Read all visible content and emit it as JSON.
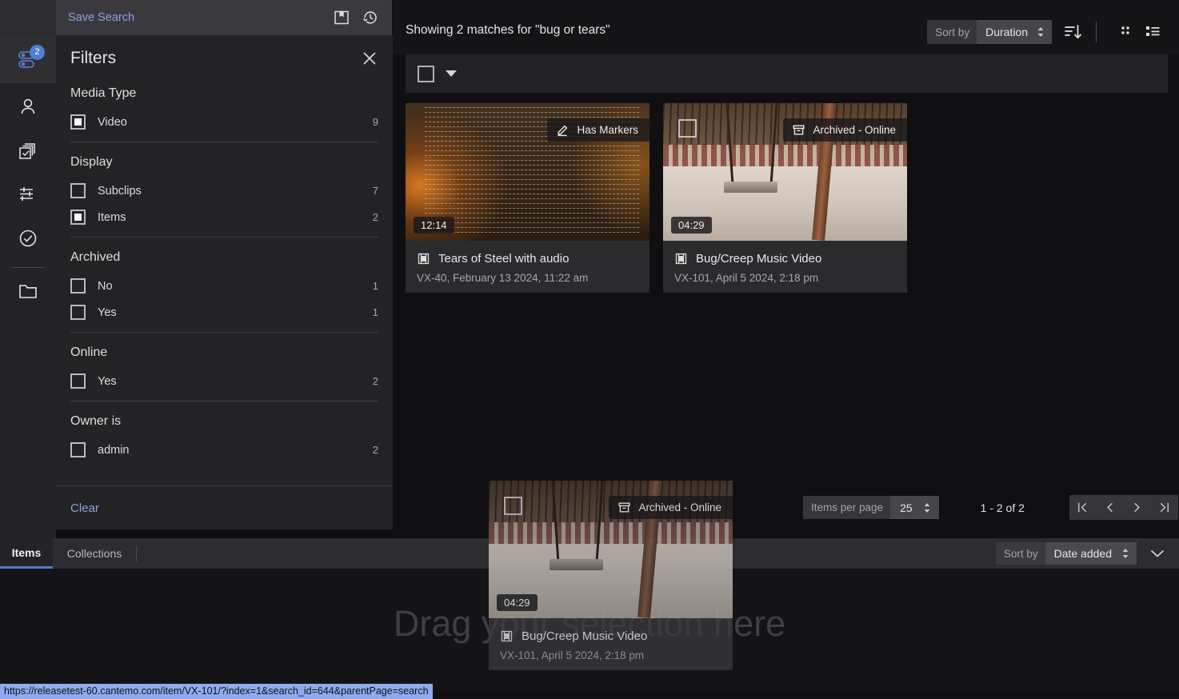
{
  "nav_rail": {
    "items": [
      {
        "name": "filters-toggle",
        "icon": "sliders-toggle-icon",
        "badge": "2",
        "active": true
      },
      {
        "name": "user",
        "icon": "person-icon",
        "badge": "",
        "active": false
      },
      {
        "name": "collections",
        "icon": "stacked-check-icon",
        "badge": "",
        "active": false
      },
      {
        "name": "settings",
        "icon": "equalizer-icon",
        "badge": "",
        "active": false
      },
      {
        "name": "approved",
        "icon": "check-circle-icon",
        "badge": "",
        "active": false
      },
      {
        "name": "folders",
        "icon": "folder-icon",
        "badge": "",
        "active": false
      }
    ]
  },
  "save_search": {
    "label": "Save Search",
    "saved_icon": "saved-searches-icon",
    "history_icon": "search-history-icon"
  },
  "filters": {
    "title": "Filters",
    "close_icon": "close-icon",
    "clear_label": "Clear",
    "groups": [
      {
        "title": "Media Type",
        "rows": [
          {
            "label": "Video",
            "count": "9",
            "checked": true
          }
        ]
      },
      {
        "title": "Display",
        "rows": [
          {
            "label": "Subclips",
            "count": "7",
            "checked": false
          },
          {
            "label": "Items",
            "count": "2",
            "checked": true
          }
        ]
      },
      {
        "title": "Archived",
        "rows": [
          {
            "label": "No",
            "count": "1",
            "checked": false
          },
          {
            "label": "Yes",
            "count": "1",
            "checked": false
          }
        ]
      },
      {
        "title": "Online",
        "rows": [
          {
            "label": "Yes",
            "count": "2",
            "checked": false
          }
        ]
      },
      {
        "title": "Owner is",
        "rows": [
          {
            "label": "admin",
            "count": "2",
            "checked": false
          }
        ]
      }
    ]
  },
  "results_header": {
    "matches_text": "Showing 2 matches for  \"bug or tears\"",
    "sort_label": "Sort by",
    "sort_value": "Duration",
    "sort_direction_icon": "sort-descending-icon",
    "grid_view_icon": "grid-view-icon",
    "list_view_icon": "list-view-icon"
  },
  "selection_bar": {
    "select_all_checked": false,
    "caret_icon": "chevron-down-icon"
  },
  "cards": [
    {
      "title": "Tears of Steel with audio",
      "meta": "VX-40, February 13 2024, 11:22 am",
      "duration": "12:14",
      "badge_text": "Has Markers",
      "badge_icon": "marker-pen-icon",
      "thumb": "credits",
      "has_checkbox": false,
      "film_icon": "film-strip-icon"
    },
    {
      "title": "Bug/Creep Music Video",
      "meta": "VX-101, April 5 2024, 2:18 pm",
      "duration": "04:29",
      "badge_text": "Archived - Online",
      "badge_icon": "archive-box-icon",
      "thumb": "swing",
      "has_checkbox": true,
      "film_icon": "film-strip-icon"
    }
  ],
  "drag_card": {
    "title": "Bug/Creep Music Video",
    "meta": "VX-101, April 5 2024, 2:18 pm",
    "duration": "04:29",
    "badge_text": "Archived - Online",
    "badge_icon": "archive-box-icon",
    "film_icon": "film-strip-icon"
  },
  "pagination": {
    "items_per_page_label": "Items per page",
    "items_per_page_value": "25",
    "range_text": "1 - 2 of 2",
    "first_icon": "first-page-icon",
    "prev_icon": "prev-page-icon",
    "next_icon": "next-page-icon",
    "last_icon": "last-page-icon"
  },
  "drop_zone": {
    "text": "Drag your selection here"
  },
  "bottom_bar": {
    "tab_items": "Items",
    "tab_collections": "Collections",
    "sort_label": "Sort by",
    "sort_value": "Date added",
    "chevron_icon": "chevron-down-icon"
  },
  "status_bar": {
    "url": "https://releasetest-60.cantemo.com/item/VX-101/?index=1&search_id=644&parentPage=search"
  },
  "colors": {
    "accent_blue": "#5579cc",
    "link_blue": "#8ba4dd",
    "panel_bg": "#232326",
    "main_bg": "#0f0f11",
    "card_bg": "#2b2b2e",
    "status_bar_bg": "#8eabef"
  }
}
